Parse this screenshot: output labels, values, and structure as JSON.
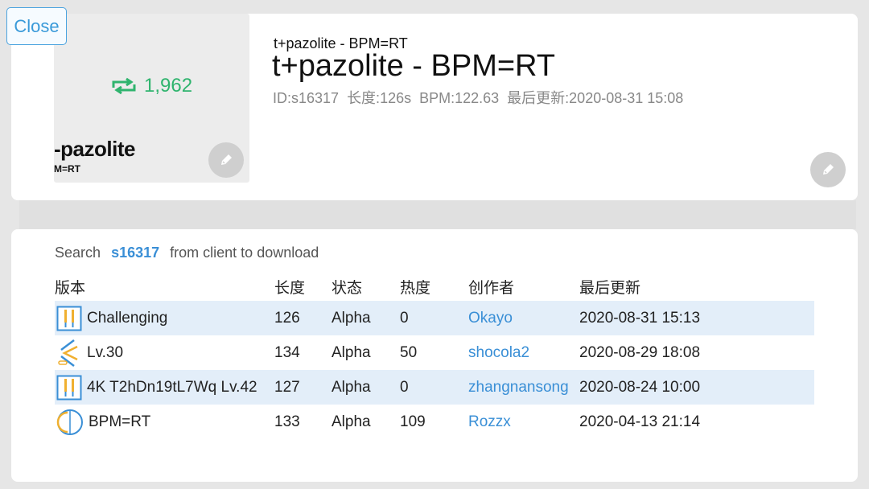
{
  "close_label": "Close",
  "cover": {
    "repost_count": "1,962",
    "title": "-pazolite",
    "subtitle": "M=RT"
  },
  "header": {
    "small_title": "t+pazolite - BPM=RT",
    "title": "t+pazolite - BPM=RT",
    "id": "ID:s16317",
    "length": "长度:126s",
    "bpm": "BPM:122.63",
    "updated": "最后更新:2020-08-31 15:08"
  },
  "search": {
    "prefix": "Search",
    "id": "s16317",
    "suffix": "from client to download"
  },
  "table": {
    "headers": [
      "版本",
      "长度",
      "状态",
      "热度",
      "创作者",
      "最后更新"
    ],
    "rows": [
      {
        "icon": "piano-key-icon",
        "version": "Challenging",
        "length": "126",
        "status": "Alpha",
        "heat": "0",
        "creator": "Okayo",
        "updated": "2020-08-31 15:13"
      },
      {
        "icon": "chevron-lanes-icon",
        "version": "Lv.30",
        "length": "134",
        "status": "Alpha",
        "heat": "50",
        "creator": "shocola2",
        "updated": "2020-08-29 18:08"
      },
      {
        "icon": "piano-key-icon",
        "version": "4K T2hDn19tL7Wq Lv.42",
        "length": "127",
        "status": "Alpha",
        "heat": "0",
        "creator": "zhangnansong",
        "updated": "2020-08-24 10:00"
      },
      {
        "icon": "circle-ring-icon",
        "version": "BPM=RT",
        "length": "133",
        "status": "Alpha",
        "heat": "109",
        "creator": "Rozzx",
        "updated": "2020-04-13 21:14"
      }
    ]
  },
  "colors": {
    "accent": "#3a8fd6",
    "repost": "#2fb46e",
    "row_highlight": "#e3eef9"
  }
}
